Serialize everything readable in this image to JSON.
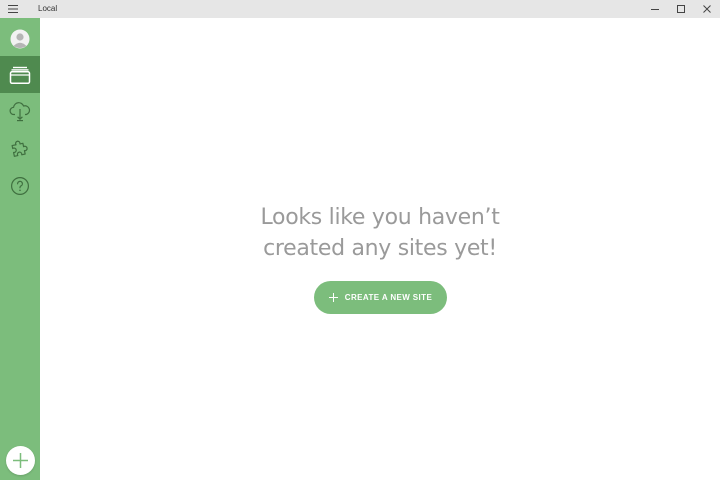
{
  "window": {
    "title": "Local",
    "controls": [
      "minimize",
      "maximize",
      "close"
    ]
  },
  "colors": {
    "sidebar": "#7cbd7c",
    "sidebar_active": "#4f8a4f",
    "accent": "#7cbd7c",
    "heading_text": "#9a9a9a",
    "titlebar": "#e6e6e6"
  },
  "sidebar": {
    "items": [
      {
        "icon": "user-avatar-icon",
        "active": false
      },
      {
        "icon": "sites-icon",
        "active": true
      },
      {
        "icon": "cloud-connect-icon",
        "active": false
      },
      {
        "icon": "puzzle-addons-icon",
        "active": false
      },
      {
        "icon": "help-icon",
        "active": false
      }
    ],
    "add_button_icon": "plus-icon"
  },
  "main": {
    "empty_line1": "Looks like you haven’t",
    "empty_line2": "created any sites yet!",
    "create_button_label": "CREATE A NEW SITE"
  }
}
